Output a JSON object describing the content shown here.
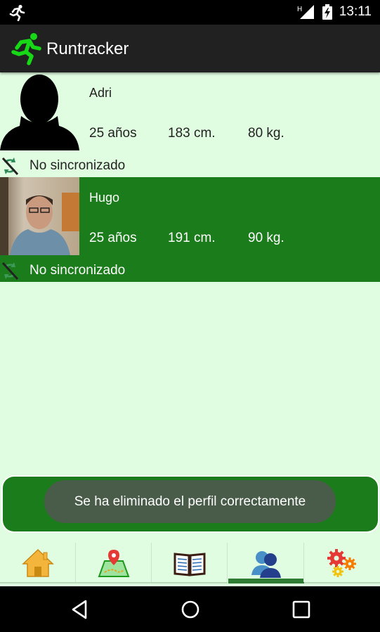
{
  "status_bar": {
    "time": "13:11",
    "signal_label": "H",
    "left_icon": "running-man-icon",
    "battery_icon": "battery-charging-icon"
  },
  "app_bar": {
    "title": "Runtracker",
    "logo_icon": "green-runner-icon"
  },
  "profiles": [
    {
      "name": "Adri",
      "age": "25 años",
      "height": "183 cm.",
      "weight": "80 kg.",
      "sync_status": "No sincronizado",
      "avatar": "silhouette-avatar",
      "selected": false
    },
    {
      "name": "Hugo",
      "age": "25 años",
      "height": "191 cm.",
      "weight": "90 kg.",
      "sync_status": "No sincronizado",
      "avatar": "photo-avatar",
      "selected": true
    }
  ],
  "toast": {
    "message": "Se ha eliminado el perfil correctamente"
  },
  "tabs": [
    {
      "name": "home",
      "icon": "home-icon"
    },
    {
      "name": "map",
      "icon": "map-pin-icon"
    },
    {
      "name": "log",
      "icon": "open-book-icon"
    },
    {
      "name": "profiles",
      "icon": "users-icon",
      "active": true
    },
    {
      "name": "settings",
      "icon": "gears-icon"
    }
  ],
  "colors": {
    "background": "#e1fde1",
    "accent_green": "#1b7c1b",
    "app_bar": "#212121"
  }
}
